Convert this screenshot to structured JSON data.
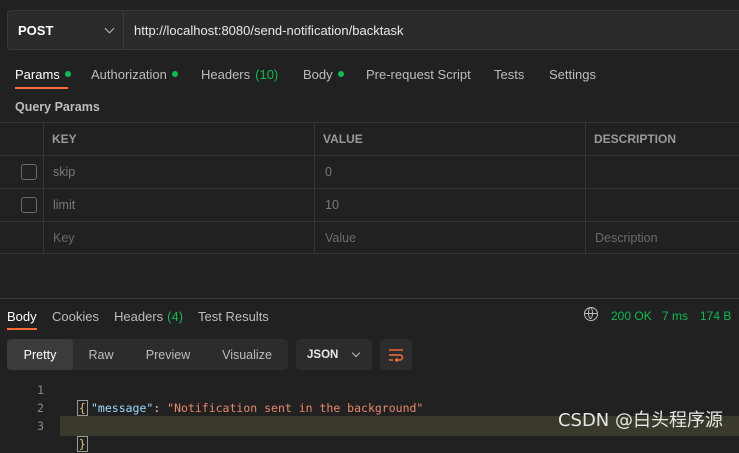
{
  "request": {
    "method": "POST",
    "url": "http://localhost:8080/send-notification/backtask"
  },
  "request_tabs": [
    {
      "label": "Params",
      "dot": true,
      "active": true
    },
    {
      "label": "Authorization",
      "dot": true
    },
    {
      "label": "Headers",
      "count": "(10)"
    },
    {
      "label": "Body",
      "dot": true
    },
    {
      "label": "Pre-request Script"
    },
    {
      "label": "Tests"
    },
    {
      "label": "Settings"
    }
  ],
  "query_params": {
    "title": "Query Params",
    "columns": [
      "KEY",
      "VALUE",
      "DESCRIPTION"
    ],
    "rows": [
      {
        "key": "skip",
        "value": "0",
        "description": ""
      },
      {
        "key": "limit",
        "value": "10",
        "description": ""
      }
    ],
    "placeholder": {
      "key": "Key",
      "value": "Value",
      "description": "Description"
    }
  },
  "response_tabs": [
    {
      "label": "Body",
      "active": true
    },
    {
      "label": "Cookies"
    },
    {
      "label": "Headers",
      "count": "(4)"
    },
    {
      "label": "Test Results"
    }
  ],
  "response_meta": {
    "status": "200 OK",
    "time": "7 ms",
    "size": "174 B"
  },
  "view_modes": [
    "Pretty",
    "Raw",
    "Preview",
    "Visualize"
  ],
  "format": "JSON",
  "code": {
    "line_numbers": [
      "1",
      "2",
      "3"
    ],
    "open": "{",
    "key": "\"message\"",
    "colon": ": ",
    "value": "\"Notification sent in the background\"",
    "close": "}"
  },
  "watermark": "CSDN @白头程序源",
  "colors": {
    "accent": "#ff6c37",
    "success": "#0cbb52"
  }
}
